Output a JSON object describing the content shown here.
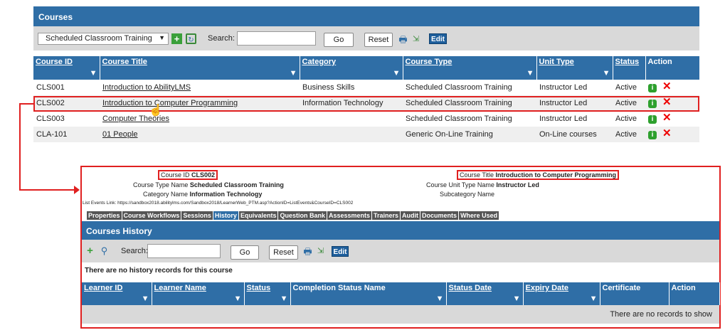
{
  "courses": {
    "title": "Courses",
    "toolbar": {
      "select_value": "Scheduled Classroom Training",
      "search_label": "Search:",
      "search_value": "",
      "go_label": "Go",
      "reset_label": "Reset",
      "edit_label": "Edit"
    },
    "columns": [
      "Course ID",
      "Course Title",
      "Category",
      "Course Type",
      "Unit Type",
      "Status",
      "Action"
    ],
    "rows": [
      {
        "id": "CLS001",
        "title": "Introduction to AbilityLMS",
        "category": "Business Skills",
        "type": "Scheduled Classroom Training",
        "unit": "Instructor Led",
        "status": "Active"
      },
      {
        "id": "CLS002",
        "title": "Introduction to Computer Programming",
        "category": "Information Technology",
        "type": "Scheduled Classroom Training",
        "unit": "Instructor Led",
        "status": "Active"
      },
      {
        "id": "CLS003",
        "title": "Computer Theories",
        "category": "",
        "type": "Scheduled Classroom Training",
        "unit": "Instructor Led",
        "status": "Active"
      },
      {
        "id": "CLA-101",
        "title": "01 People",
        "category": "",
        "type": "Generic On-Line Training",
        "unit": "On-Line courses",
        "status": "Active"
      }
    ]
  },
  "detail": {
    "course_id_label": "Course ID",
    "course_id_value": "CLS002",
    "course_title_label": "Course Title",
    "course_title_value": "Introduction to Computer Programming",
    "course_type_label": "Course Type Name",
    "course_type_value": "Scheduled Classroom Training",
    "unit_type_label": "Course Unit Type Name",
    "unit_type_value": "Instructor Led",
    "category_label": "Category Name",
    "category_value": "Information Technology",
    "subcategory_label": "Subcategory Name",
    "subcategory_value": "",
    "list_events_link": "List Events Link: https://sandbox2018.abilitylms.com/Sandbox2018/LearnerWeb_PTM.asp?ActionID=ListEvents&CourseID=CLS002",
    "tabs": [
      "Properties",
      "Course Workflows",
      "Sessions",
      "History",
      "Equivalents",
      "Question Bank",
      "Assessments",
      "Trainers",
      "Audit",
      "Documents",
      "Where Used"
    ],
    "active_tab": "History"
  },
  "history": {
    "title": "Courses History",
    "search_label": "Search:",
    "go_label": "Go",
    "reset_label": "Reset",
    "edit_label": "Edit",
    "no_records_msg": "There are no history records for this course",
    "columns": [
      "Learner ID",
      "Learner Name",
      "Status",
      "Completion Status Name",
      "Status Date",
      "Expiry Date",
      "Certificate",
      "Action"
    ],
    "empty_msg": "There are no records to show"
  },
  "colors": {
    "header_blue": "#2f6ea6",
    "highlight_red": "#e02020"
  }
}
